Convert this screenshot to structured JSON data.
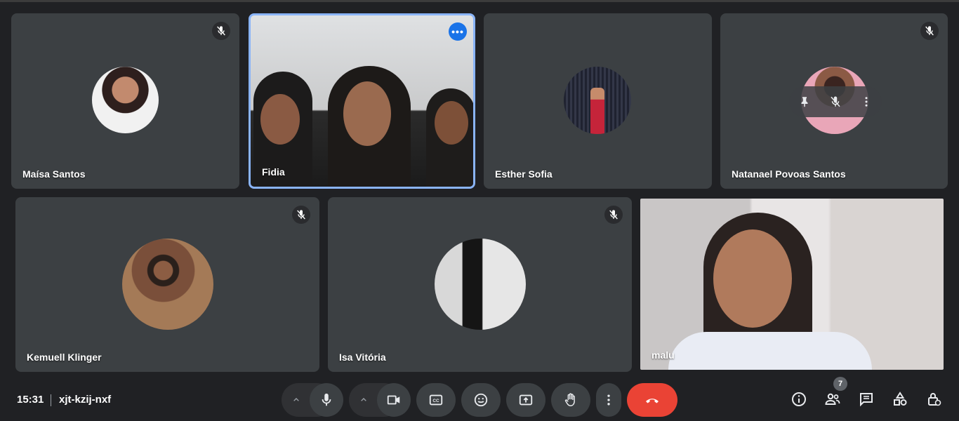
{
  "participants": [
    {
      "name": "Maísa Santos"
    },
    {
      "name": "Fidia"
    },
    {
      "name": "Esther Sofia"
    },
    {
      "name": "Natanael Povoas Santos"
    },
    {
      "name": "Kemuell Klinger"
    },
    {
      "name": "Isa Vitória"
    },
    {
      "name": "malu"
    }
  ],
  "meeting": {
    "time": "15:31",
    "code": "xjt-kzij-nxf"
  },
  "people_count": "7",
  "colors": {
    "leave": "#ea4335",
    "accent": "#8ab4f8",
    "more": "#1a73e8",
    "tile": "#3c4043"
  },
  "icons": [
    "mic-off-icon",
    "more-dots-icon",
    "pin-icon",
    "more-vert-icon",
    "chevron-up-icon",
    "mic-icon",
    "camera-icon",
    "captions-icon",
    "emoji-icon",
    "present-icon",
    "raise-hand-icon",
    "call-end-icon",
    "info-icon",
    "people-icon",
    "chat-icon",
    "activities-icon",
    "host-controls-icon"
  ]
}
